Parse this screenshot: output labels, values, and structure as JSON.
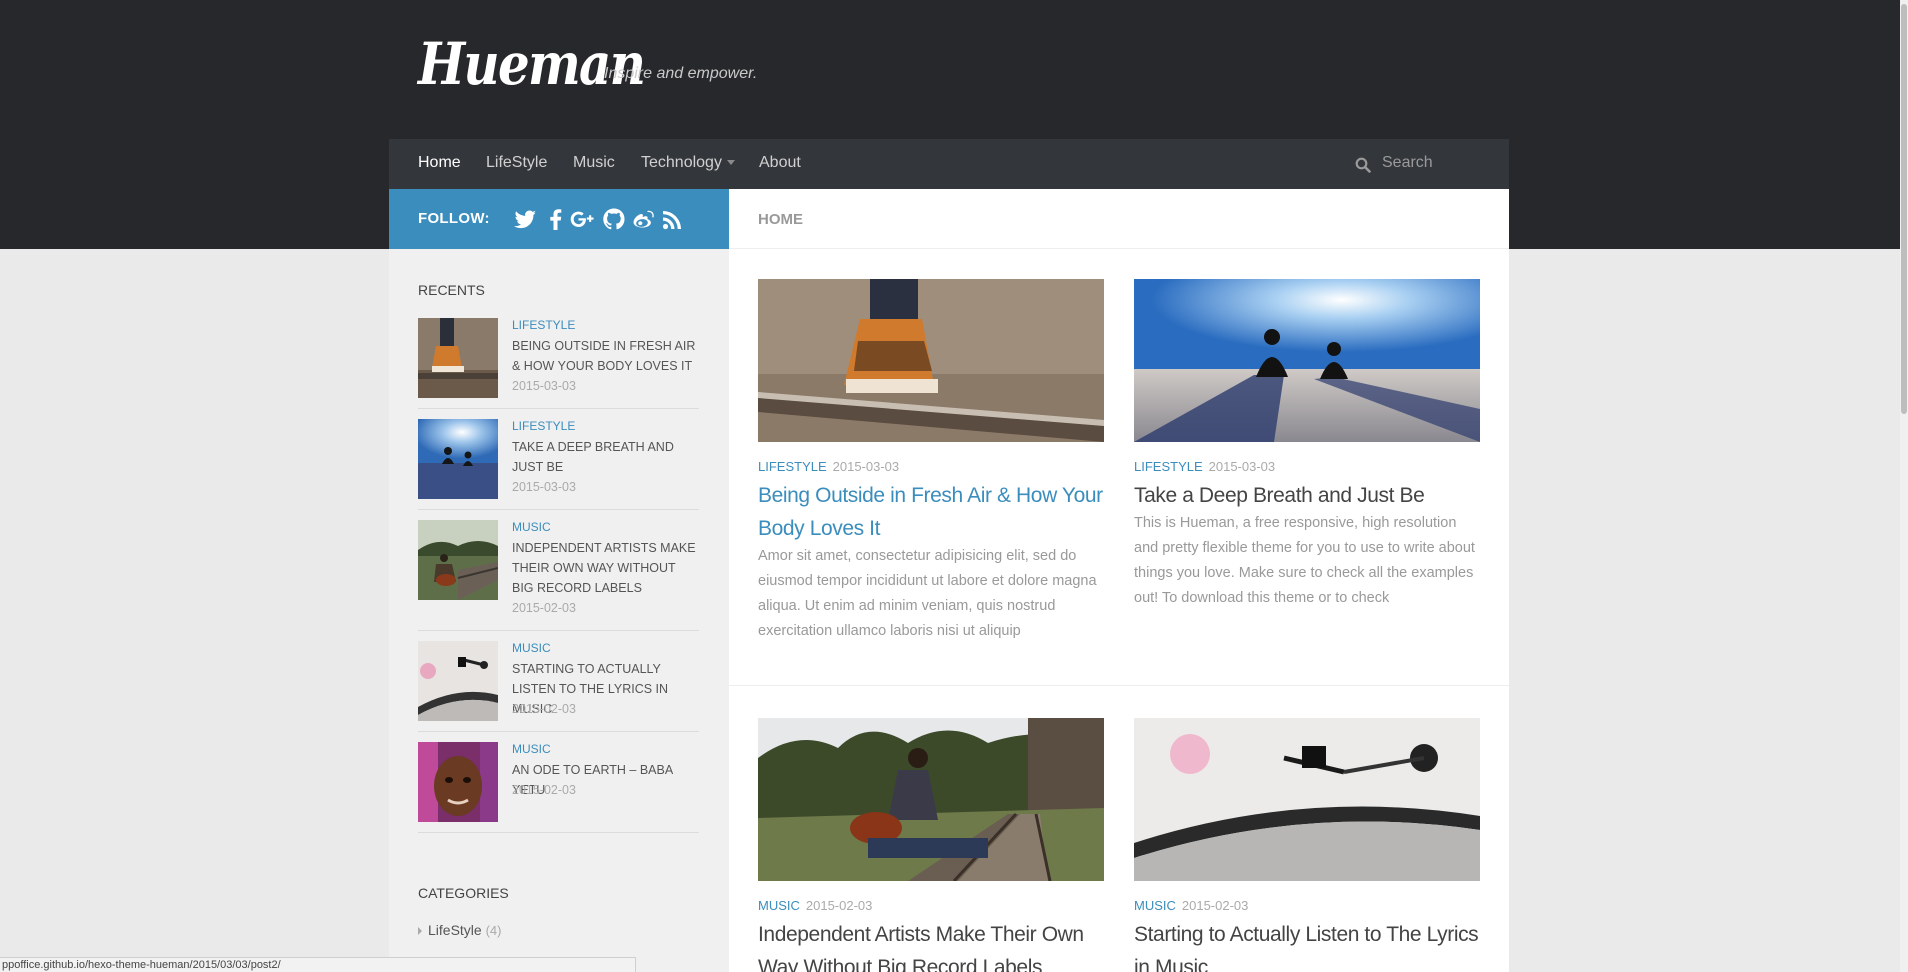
{
  "site": {
    "title": "Hueman",
    "tagline": "Inspire and empower."
  },
  "nav": {
    "items": [
      {
        "label": "Home",
        "active": true
      },
      {
        "label": "LifeStyle"
      },
      {
        "label": "Music"
      },
      {
        "label": "Technology",
        "has_dropdown": true
      },
      {
        "label": "About"
      }
    ],
    "search_placeholder": "Search"
  },
  "follow": {
    "label": "FOLLOW:",
    "icons": [
      "twitter-icon",
      "facebook-icon",
      "google-plus-icon",
      "github-icon",
      "weibo-icon",
      "rss-icon"
    ]
  },
  "breadcrumb": "HOME",
  "sidebar": {
    "recents_heading": "RECENTS",
    "recents": [
      {
        "category": "LIFESTYLE",
        "title": "BEING OUTSIDE IN FRESH AIR & HOW YOUR BODY LOVES IT",
        "date": "2015-03-03"
      },
      {
        "category": "LIFESTYLE",
        "title": "TAKE A DEEP BREATH AND JUST BE",
        "date": "2015-03-03"
      },
      {
        "category": "MUSIC",
        "title": "INDEPENDENT ARTISTS MAKE THEIR OWN WAY WITHOUT BIG RECORD LABELS",
        "date": "2015-02-03"
      },
      {
        "category": "MUSIC",
        "title": "STARTING TO ACTUALLY LISTEN TO THE LYRICS IN MUSIC",
        "date": "2015-02-03"
      },
      {
        "category": "MUSIC",
        "title": "AN ODE TO EARTH – BABA YETU",
        "date": "2015-02-03"
      }
    ],
    "categories_heading": "CATEGORIES",
    "categories": [
      {
        "name": "LifeStyle",
        "count": "(4)"
      }
    ]
  },
  "posts": [
    {
      "category": "LIFESTYLE",
      "date": "2015-03-03",
      "title": "Being Outside in Fresh Air & How Your Body Loves It",
      "excerpt": "Amor sit amet, consectetur adipisicing elit, sed do eiusmod tempor incididunt ut labore et dolore magna aliqua. Ut enim ad minim veniam, quis nostrud exercitation ullamco laboris nisi ut aliquip"
    },
    {
      "category": "LIFESTYLE",
      "date": "2015-03-03",
      "title": "Take a Deep Breath and Just Be",
      "excerpt": "This is Hueman, a free responsive, high resolution and pretty flexible theme for you to use to write about things you love. Make sure to check all the examples out! To download this theme or to check"
    },
    {
      "category": "MUSIC",
      "date": "2015-02-03",
      "title": "Independent Artists Make Their Own Way Without Big Record Labels"
    },
    {
      "category": "MUSIC",
      "date": "2015-02-03",
      "title": "Starting to Actually Listen to The Lyrics in Music"
    }
  ],
  "status_url": "ppoffice.github.io/hexo-theme-hueman/2015/03/03/post2/",
  "colors": {
    "accent": "#3b8dbd",
    "header": "#27282c",
    "nav": "#33363b"
  }
}
